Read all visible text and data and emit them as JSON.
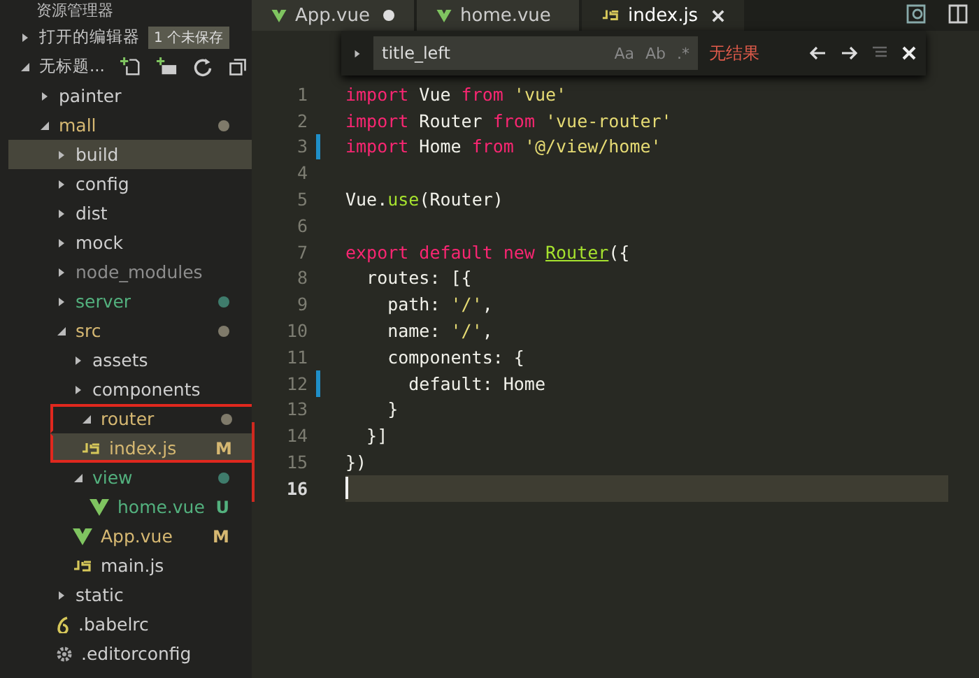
{
  "sidebar": {
    "title": "资源管理器",
    "open_editors": {
      "label": "打开的编辑器",
      "expanded": false,
      "badge": "1 个未保存"
    },
    "workspace": {
      "label": "无标题...",
      "expanded": true
    },
    "tree": [
      {
        "name": "painter",
        "kind": "folder",
        "expanded": false,
        "color": "#cfcfcf",
        "selected": false,
        "outlined": false
      },
      {
        "name": "mall",
        "kind": "folder",
        "expanded": true,
        "color": "#d6b872",
        "dot": {
          "color": "#7f7a6a"
        },
        "selected": false,
        "outlined": false,
        "children": [
          {
            "name": "build",
            "kind": "folder",
            "expanded": false,
            "color": "#cfcfcf",
            "selected": true,
            "outlined": false
          },
          {
            "name": "config",
            "kind": "folder",
            "expanded": false,
            "color": "#cfcfcf",
            "selected": false,
            "outlined": false
          },
          {
            "name": "dist",
            "kind": "folder",
            "expanded": false,
            "color": "#cfcfcf",
            "selected": false,
            "outlined": false
          },
          {
            "name": "mock",
            "kind": "folder",
            "expanded": false,
            "color": "#cfcfcf",
            "selected": false,
            "outlined": false
          },
          {
            "name": "node_modules",
            "kind": "folder",
            "expanded": false,
            "color": "#8d8d8d",
            "selected": false,
            "outlined": false
          },
          {
            "name": "server",
            "kind": "folder",
            "expanded": false,
            "color": "#53b17e",
            "dot": {
              "color": "#3f7c6c"
            },
            "selected": false,
            "outlined": false
          },
          {
            "name": "src",
            "kind": "folder",
            "expanded": true,
            "color": "#d6b872",
            "dot": {
              "color": "#7f7a6a"
            },
            "selected": false,
            "outlined": false,
            "children": [
              {
                "name": "assets",
                "kind": "folder",
                "expanded": false,
                "color": "#cfcfcf",
                "selected": false,
                "outlined": false
              },
              {
                "name": "components",
                "kind": "folder",
                "expanded": false,
                "color": "#cfcfcf",
                "selected": false,
                "outlined": false
              },
              {
                "name": "router",
                "kind": "folder",
                "expanded": true,
                "color": "#d6b872",
                "dot": {
                  "color": "#7f7a6a"
                },
                "selected": false,
                "outlined": true,
                "children": [
                  {
                    "name": "index.js",
                    "kind": "js",
                    "color": "#d6b872",
                    "badge": "M",
                    "selected": true,
                    "outlined": true
                  }
                ]
              },
              {
                "name": "view",
                "kind": "folder",
                "expanded": true,
                "color": "#53b17e",
                "dot": {
                  "color": "#3f7c6c"
                },
                "selected": false,
                "outlined": false,
                "children": [
                  {
                    "name": "home.vue",
                    "kind": "vue",
                    "color": "#53b17e",
                    "badge": "U",
                    "selected": false,
                    "outlined": false
                  }
                ]
              },
              {
                "name": "App.vue",
                "kind": "vue",
                "color": "#d6b872",
                "badge": "M",
                "selected": false,
                "outlined": false
              },
              {
                "name": "main.js",
                "kind": "js",
                "color": "#cfcfcf",
                "selected": false,
                "outlined": false
              }
            ]
          },
          {
            "name": "static",
            "kind": "folder",
            "expanded": false,
            "color": "#cfcfcf",
            "selected": false,
            "outlined": false
          },
          {
            "name": ".babelrc",
            "kind": "babel",
            "color": "#cfcfcf",
            "selected": false,
            "outlined": false
          },
          {
            "name": ".editorconfig",
            "kind": "config",
            "color": "#cfcfcf",
            "selected": false,
            "outlined": false
          }
        ]
      }
    ]
  },
  "tabs": [
    {
      "label": "App.vue",
      "kind": "vue",
      "selected": false,
      "dirty": true
    },
    {
      "label": "home.vue",
      "kind": "vue",
      "selected": false,
      "dirty": false
    },
    {
      "label": "index.js",
      "kind": "js",
      "selected": true,
      "dirty": false
    }
  ],
  "find": {
    "value": "title_left",
    "options": [
      "Aa",
      "Ab",
      ".*"
    ],
    "status": "无结果"
  },
  "code": [
    {
      "number": "1",
      "modified": false,
      "edge": false,
      "current": false,
      "tokens": [
        {
          "t": "import",
          "color": "#f92672"
        },
        {
          "t": " Vue ",
          "color": "#f1f1ea"
        },
        {
          "t": "from",
          "color": "#f92672"
        },
        {
          "t": " 'vue'",
          "color": "#e6db74"
        }
      ]
    },
    {
      "number": "2",
      "modified": false,
      "edge": false,
      "current": false,
      "tokens": [
        {
          "t": "import",
          "color": "#f92672"
        },
        {
          "t": " Router ",
          "color": "#f1f1ea"
        },
        {
          "t": "from",
          "color": "#f92672"
        },
        {
          "t": " 'vue-router'",
          "color": "#e6db74"
        }
      ]
    },
    {
      "number": "3",
      "modified": true,
      "edge": false,
      "current": false,
      "tokens": [
        {
          "t": "import",
          "color": "#f92672"
        },
        {
          "t": " Home ",
          "color": "#f1f1ea"
        },
        {
          "t": "from",
          "color": "#f92672"
        },
        {
          "t": " '@/view/home'",
          "color": "#e6db74"
        }
      ]
    },
    {
      "number": "4",
      "modified": false,
      "edge": false,
      "current": false
    },
    {
      "number": "5",
      "modified": false,
      "edge": false,
      "current": false,
      "tokens": [
        {
          "t": "Vue.",
          "color": "#f1f1ea"
        },
        {
          "t": "use",
          "color": "#a6e22e"
        },
        {
          "t": "(Router)",
          "color": "#f1f1ea"
        }
      ]
    },
    {
      "number": "6",
      "modified": false,
      "edge": false,
      "current": false
    },
    {
      "number": "7",
      "modified": false,
      "edge": false,
      "current": false,
      "tokens": [
        {
          "t": "export default new ",
          "color": "#f92672"
        },
        {
          "t": "Router",
          "color": "#a6e22e",
          "underline": true
        },
        {
          "t": "({",
          "color": "#f1f1ea"
        }
      ]
    },
    {
      "number": "8",
      "modified": false,
      "edge": false,
      "current": false,
      "tokens": [
        {
          "t": "  routes: [{",
          "color": "#f1f1ea"
        }
      ]
    },
    {
      "number": "9",
      "modified": false,
      "edge": false,
      "current": false,
      "tokens": [
        {
          "t": "    path: ",
          "color": "#f1f1ea"
        },
        {
          "t": "'/'",
          "color": "#e6db74"
        },
        {
          "t": ",",
          "color": "#f1f1ea"
        }
      ]
    },
    {
      "number": "10",
      "modified": false,
      "edge": false,
      "current": false,
      "tokens": [
        {
          "t": "    name: ",
          "color": "#f1f1ea"
        },
        {
          "t": "'/'",
          "color": "#e6db74"
        },
        {
          "t": ",",
          "color": "#f1f1ea"
        }
      ]
    },
    {
      "number": "11",
      "modified": false,
      "edge": false,
      "current": false,
      "tokens": [
        {
          "t": "    components: {",
          "color": "#f1f1ea"
        }
      ]
    },
    {
      "number": "12",
      "modified": true,
      "edge": false,
      "current": false,
      "tokens": [
        {
          "t": "      default: Home",
          "color": "#f1f1ea"
        }
      ]
    },
    {
      "number": "13",
      "modified": false,
      "edge": false,
      "current": false,
      "tokens": [
        {
          "t": "    }",
          "color": "#f1f1ea"
        }
      ]
    },
    {
      "number": "14",
      "modified": false,
      "edge": true,
      "current": false,
      "tokens": [
        {
          "t": "  }]",
          "color": "#f1f1ea"
        }
      ]
    },
    {
      "number": "15",
      "modified": false,
      "edge": true,
      "current": false,
      "tokens": [
        {
          "t": "})",
          "color": "#f1f1ea"
        }
      ]
    },
    {
      "number": "16",
      "modified": false,
      "edge": true,
      "current": true
    }
  ]
}
